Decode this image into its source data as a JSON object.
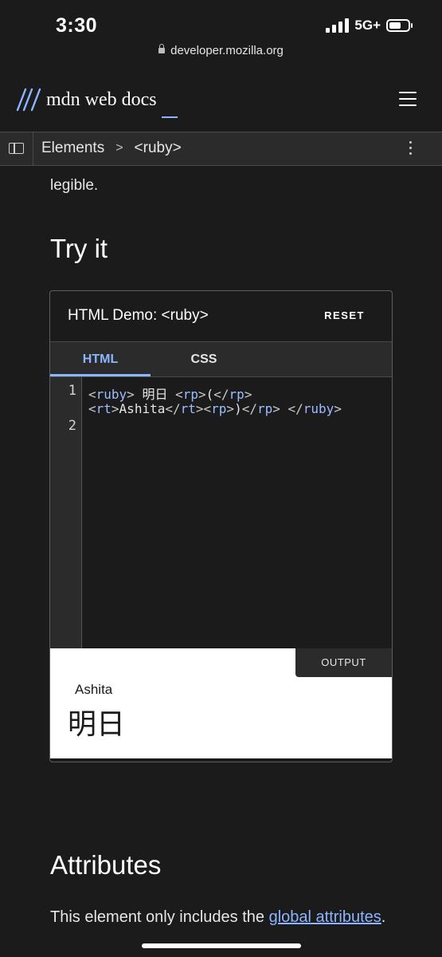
{
  "status_bar": {
    "time": "3:30",
    "network": "5G+",
    "url": "developer.mozilla.org"
  },
  "header": {
    "logo_text": "mdn web docs",
    "menu_icon": "hamburger-icon"
  },
  "breadcrumb": {
    "items": [
      "Elements",
      "<ruby>"
    ],
    "separator": ">"
  },
  "content": {
    "partial_paragraph": "legible.",
    "try_heading": "Try it",
    "attributes_heading": "Attributes",
    "attributes_text": "This element only includes the ",
    "attributes_link": "global attributes",
    "attributes_end": "."
  },
  "demo": {
    "title": "HTML Demo: <ruby>",
    "reset_label": "RESET",
    "tabs": [
      {
        "label": "HTML",
        "active": true
      },
      {
        "label": "CSS",
        "active": false
      }
    ],
    "line_numbers": [
      "1",
      "2"
    ],
    "code": {
      "line1": {
        "ruby_open_lt": "<",
        "ruby_open_tag": "ruby",
        "ruby_open_gt": ">",
        "base_text": " 明日 ",
        "rp1_lt": "<",
        "rp1_tag": "rp",
        "rp1_gt": ">",
        "rp1_text": "(",
        "rp1_close_lt": "</",
        "rp1_close_tag": "rp",
        "rp1_close_gt": ">"
      },
      "line1b": {
        "rt_lt": "<",
        "rt_tag": "rt",
        "rt_gt": ">",
        "rt_text": "Ashita",
        "rt_close_lt": "</",
        "rt_close_tag": "rt",
        "rt_close_gt": ">",
        "rp2_lt": "<",
        "rp2_tag": "rp",
        "rp2_gt": ">",
        "rp2_text": ")",
        "rp2_close_lt": "</",
        "rp2_close_tag": "rp",
        "rp2_close_gt": ">",
        "space": " ",
        "ruby_close_lt": "</",
        "ruby_close_tag": "ruby",
        "ruby_close_gt": ">"
      }
    },
    "output_label": "OUTPUT",
    "output": {
      "ruby_annotation": "Ashita",
      "ruby_base": "明日"
    }
  },
  "colors": {
    "background": "#1b1b1b",
    "accent": "#8cb4ff",
    "panel": "#2b2b2b"
  }
}
